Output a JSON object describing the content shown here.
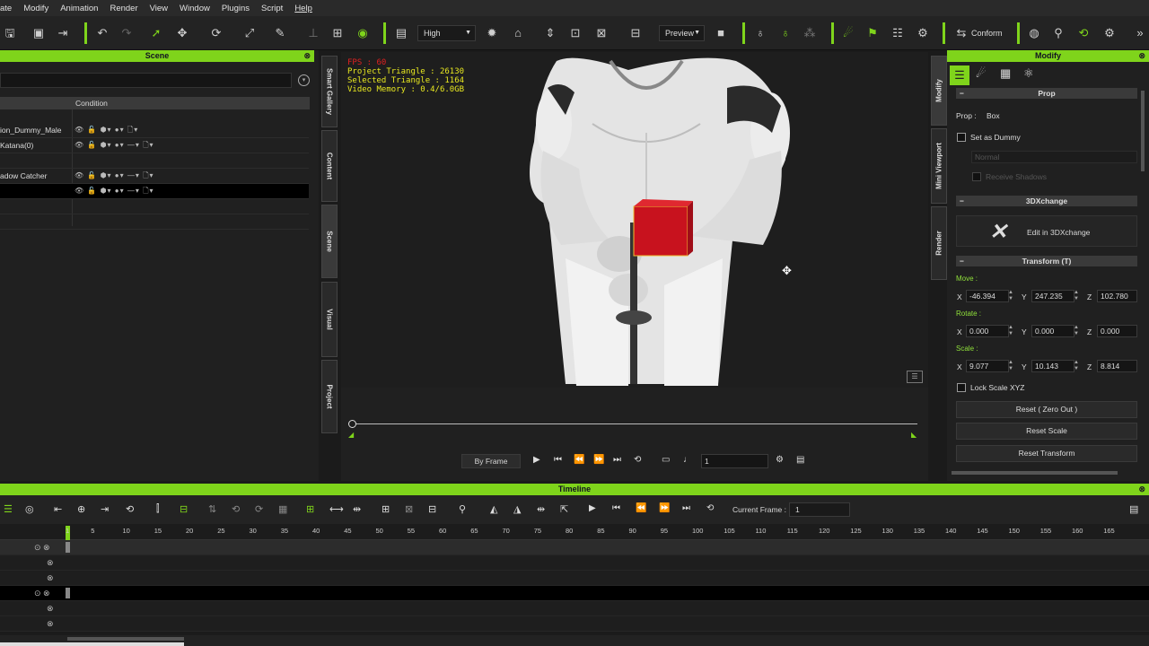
{
  "menu": [
    "ate",
    "Modify",
    "Animation",
    "Render",
    "View",
    "Window",
    "Plugins",
    "Script",
    "Help"
  ],
  "toolbar": {
    "quality": "High",
    "preview": "Preview",
    "conform": "Conform"
  },
  "scene": {
    "title": "Scene",
    "column_condition": "Condition",
    "rows": [
      {
        "name": "ion_Dummy_Male",
        "icons": "👁 🔓 ⬢▾ ●▾ 🗋▾"
      },
      {
        "name": "Katana(0)",
        "icons": "👁 🔓 ⬢▾ ●▾ —▾ 🗋▾"
      },
      {
        "name": "",
        "icons": ""
      },
      {
        "name": "adow Catcher",
        "icons": "👁 🔓 ⬢▾ ●▾ —▾ 🗋▾"
      },
      {
        "name": "",
        "icons": "👁 🔓 ⬢▾ ●▾ —▾ 🗋▾"
      },
      {
        "name": "",
        "icons": ""
      },
      {
        "name": "",
        "icons": ""
      }
    ]
  },
  "left_tabs": [
    "Smart Gallery",
    "Content",
    "Scene",
    "Visual",
    "Project"
  ],
  "right_tabs": [
    "Modify",
    "Mini Viewport",
    "Render"
  ],
  "viewport": {
    "fps": "FPS : 60",
    "project_triangle": "Project Triangle : 26130",
    "selected_triangle": "Selected Triangle : 1164",
    "video_memory": "Video Memory : 0.4/6.0GB"
  },
  "playback": {
    "mode": "By Frame",
    "frame": "1"
  },
  "modify": {
    "title": "Modify",
    "prop_section": "Prop",
    "prop_label": "Prop :",
    "prop_value": "Box",
    "set_as_dummy": "Set as Dummy",
    "normal": "Normal",
    "receive_shadows": "Receive Shadows",
    "threedx_section": "3DXchange",
    "edit_3dx": "Edit in 3DXchange",
    "transform_section": "Transform  (T)",
    "move_label": "Move :",
    "rotate_label": "Rotate :",
    "scale_label": "Scale :",
    "move": {
      "x": "-46.394",
      "y": "247.235",
      "z": "102.780"
    },
    "rotate": {
      "x": "0.000",
      "y": "0.000",
      "z": "0.000"
    },
    "scale": {
      "x": "9.077",
      "y": "10.143",
      "z": "8.814"
    },
    "lock_scale": "Lock Scale XYZ",
    "reset_zero": "Reset ( Zero Out )",
    "reset_scale": "Reset Scale",
    "reset_transform": "Reset Transform"
  },
  "timeline": {
    "title": "Timeline",
    "current_frame_label": "Current Frame :",
    "current_frame": "1",
    "ticks": [
      "1",
      "5",
      "10",
      "15",
      "20",
      "25",
      "30",
      "35",
      "40",
      "45",
      "50",
      "55",
      "60",
      "65",
      "70",
      "75",
      "80",
      "85",
      "90",
      "95",
      "100",
      "105",
      "110",
      "115",
      "120",
      "125",
      "130",
      "135",
      "140",
      "145",
      "150",
      "155",
      "160",
      "165"
    ]
  },
  "colors": {
    "accent": "#7fd41b",
    "box": "#c8121e",
    "hud_yellow": "#e8e820",
    "hud_red": "#e02020"
  }
}
